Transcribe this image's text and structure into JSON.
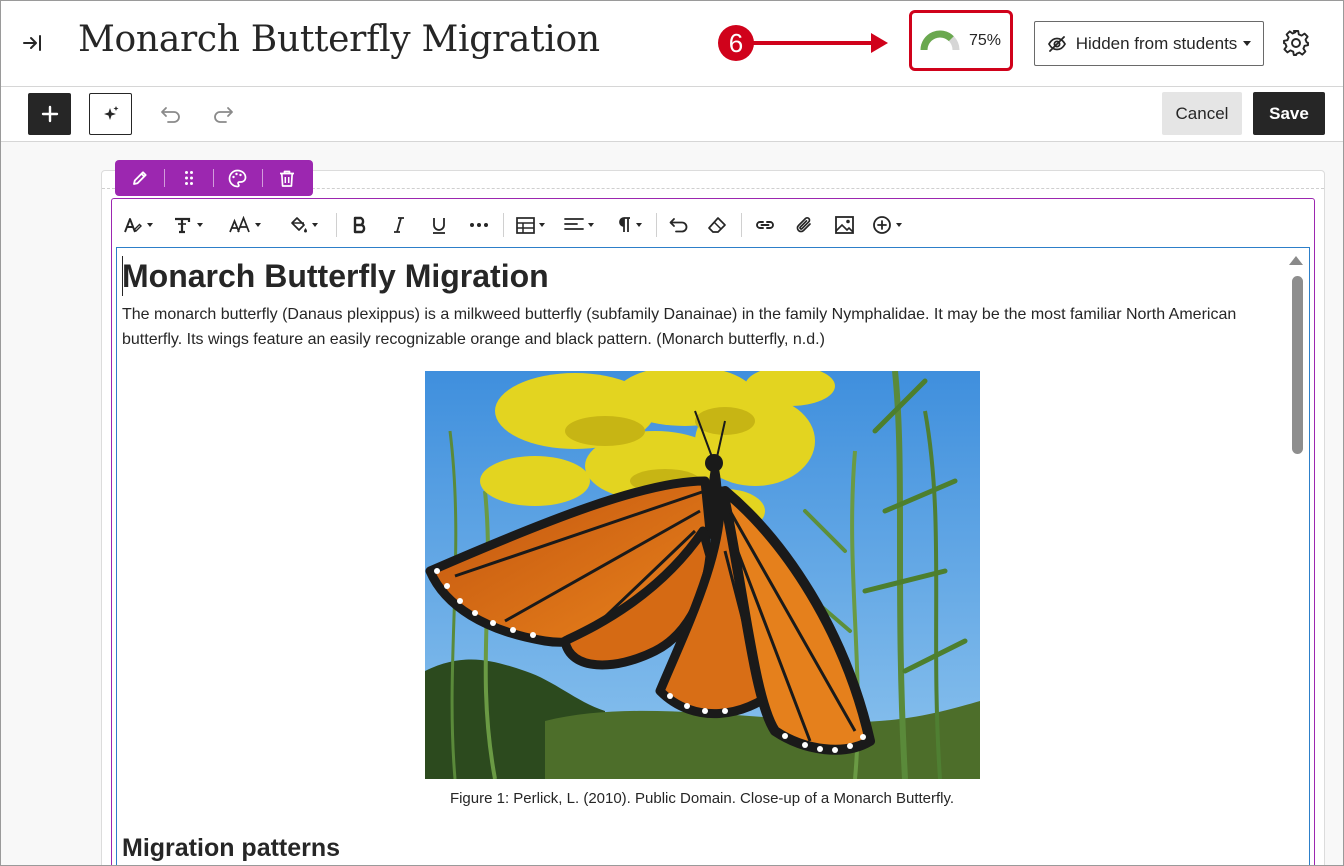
{
  "header": {
    "title": "Monarch Butterfly Migration",
    "step_number": "6",
    "accessibility_score": "75%",
    "accessibility_score_value": 0.75,
    "visibility_label": "Hidden from students",
    "icons": {
      "collapse": "collapse-panel-icon",
      "visibility": "eye-slash-icon",
      "settings": "gear-icon"
    }
  },
  "toolbar": {
    "cancel_label": "Cancel",
    "save_label": "Save",
    "icons": [
      "plus-icon",
      "ai-sparkle-icon",
      "undo-icon",
      "redo-icon"
    ]
  },
  "block_toolbar": {
    "icons": [
      "pencil-icon",
      "drag-handle-icon",
      "palette-icon",
      "trash-icon"
    ]
  },
  "format_bar": {
    "icons": [
      "paragraph-style-icon",
      "text-style-icon",
      "font-size-icon",
      "fill-color-icon",
      "bold-icon",
      "italic-icon",
      "underline-icon",
      "more-icon",
      "table-icon",
      "align-icon",
      "paragraph-icon",
      "undo-icon",
      "clear-format-icon",
      "link-icon",
      "attachment-icon",
      "image-icon",
      "insert-icon"
    ]
  },
  "document": {
    "heading": "Monarch Butterfly Migration",
    "paragraph": "The monarch butterfly (Danaus plexippus) is a milkweed butterfly (subfamily Danainae) in the family Nymphalidae. It may be the most familiar North American butterfly. Its wings feature an easily recognizable orange and black pattern. (Monarch butterfly, n.d.)",
    "image_subject": "monarch-butterfly-photo",
    "caption": "Figure 1: Perlick, L. (2010). Public Domain. Close-up of a Monarch Butterfly.",
    "subheading": "Migration patterns"
  },
  "colors": {
    "annotation_red": "#d0021b",
    "block_purple": "#9c27b0",
    "score_green": "#6aa84f",
    "dark": "#262626",
    "focus_blue": "#2d7fc9"
  }
}
